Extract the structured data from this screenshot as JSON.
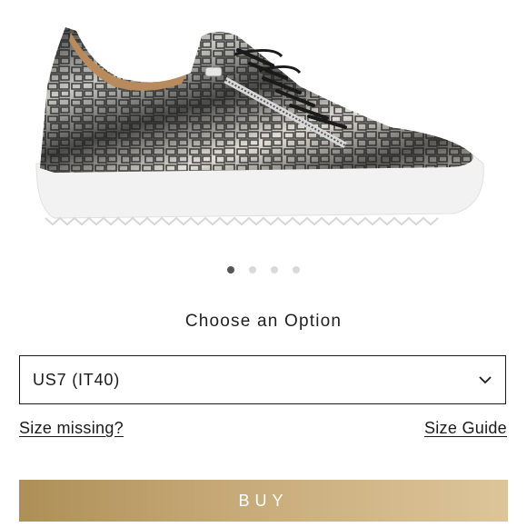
{
  "product": {
    "image_alt": "metallic croc-embossed low-top sneaker with zip",
    "carousel": {
      "count": 4,
      "active_index": 0
    }
  },
  "options": {
    "title": "Choose an Option",
    "size_select": {
      "value": "US7 (IT40)",
      "icon": "chevron-down-icon"
    },
    "size_missing_link": "Size missing?",
    "size_guide_link": "Size Guide"
  },
  "cta": {
    "buy_label": "BUY"
  },
  "colors": {
    "buy_gradient_start": "#ad8f57",
    "buy_gradient_end": "#ddc59a",
    "active_dot": "#555555",
    "inactive_dot": "#d9d9d9"
  }
}
